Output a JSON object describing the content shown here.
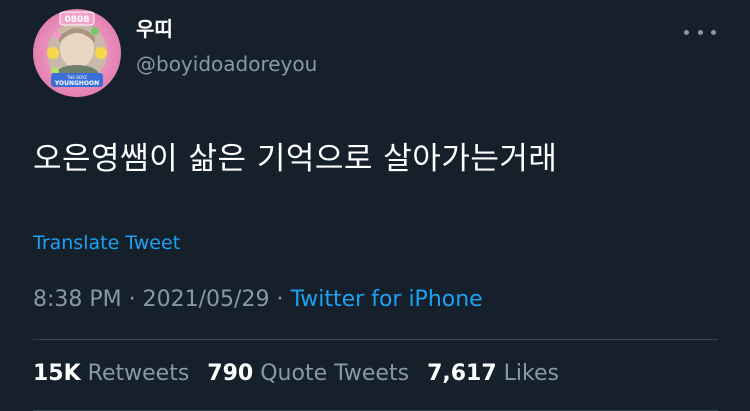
{
  "author": {
    "display_name": "우띠",
    "handle": "@boyidoadoreyou",
    "avatar_badge": "0808",
    "avatar_caption_top": "THE BOYZ",
    "avatar_caption_bottom": "YOUNGHOON"
  },
  "tweet": {
    "text": "오은영쌤이 삶은 기억으로 살아가는거래",
    "translate_label": "Translate Tweet",
    "time": "8:38 PM",
    "separator": "·",
    "date": "2021/05/29",
    "source": "Twitter for iPhone"
  },
  "stats": [
    {
      "count": "15K",
      "label": "Retweets"
    },
    {
      "count": "790",
      "label": "Quote Tweets"
    },
    {
      "count": "7,617",
      "label": "Likes"
    }
  ],
  "icons": {
    "more": "more-horizontal-icon"
  },
  "colors": {
    "background": "#15202b",
    "primary_text": "#ffffff",
    "secondary_text": "#8899a6",
    "link": "#1da1f2",
    "divider": "#38444d"
  }
}
